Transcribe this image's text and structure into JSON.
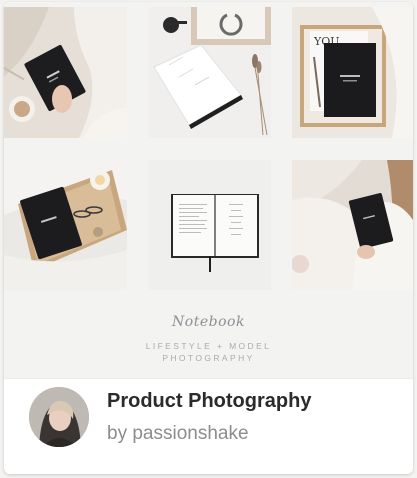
{
  "product": {
    "title": "Product Photography",
    "author": "by passionshake"
  },
  "preview": {
    "brand_script": "Notebook",
    "brand_subtitle_line1": "LIFESTYLE + MODEL",
    "brand_subtitle_line2": "PHOTOGRAPHY"
  }
}
